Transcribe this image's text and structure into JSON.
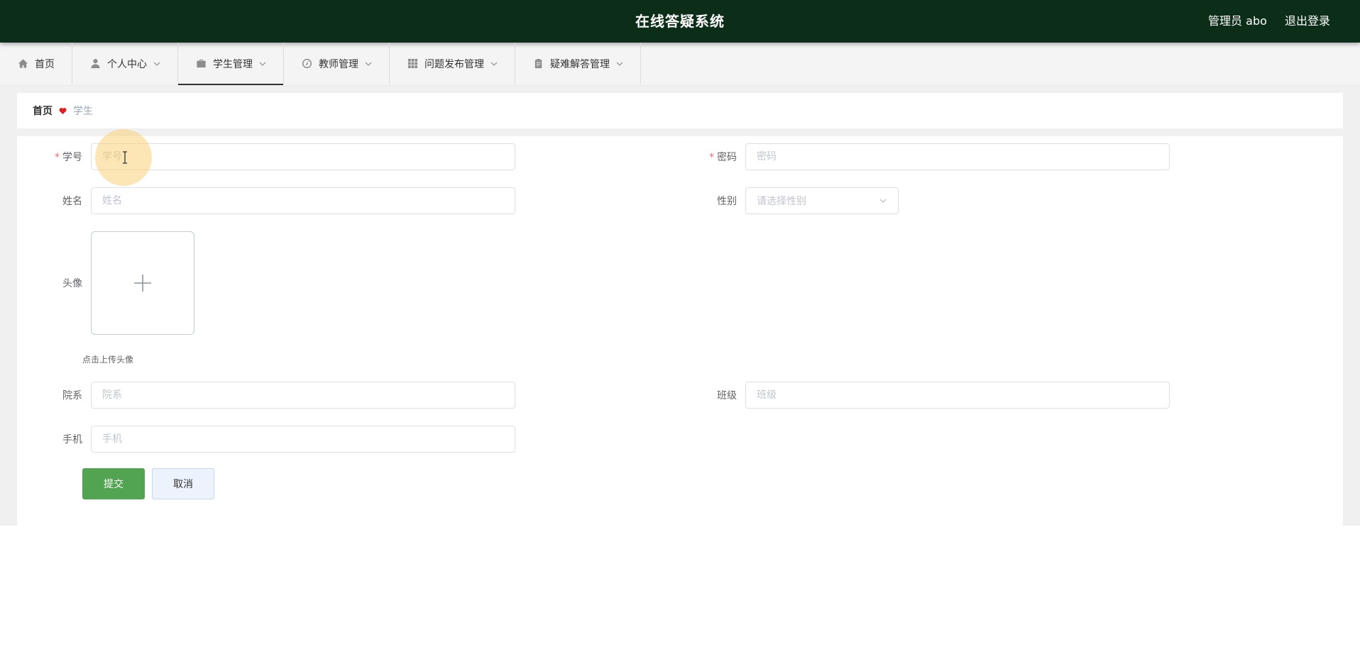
{
  "header": {
    "app_title": "在线答疑系统",
    "user_label": "管理员 abo",
    "logout_label": "退出登录"
  },
  "nav": {
    "items": [
      {
        "label": "首页",
        "icon": "home-icon",
        "has_dropdown": false
      },
      {
        "label": "个人中心",
        "icon": "user-icon",
        "has_dropdown": true
      },
      {
        "label": "学生管理",
        "icon": "briefcase-icon",
        "has_dropdown": true,
        "active": true
      },
      {
        "label": "教师管理",
        "icon": "dashboard-icon",
        "has_dropdown": true
      },
      {
        "label": "问题发布管理",
        "icon": "grid-icon",
        "has_dropdown": true
      },
      {
        "label": "疑难解答管理",
        "icon": "clipboard-icon",
        "has_dropdown": true
      }
    ]
  },
  "breadcrumb": {
    "home": "首页",
    "separator_icon": "heart-icon",
    "current": "学生"
  },
  "form": {
    "student_id": {
      "label": "学号",
      "placeholder": "学号",
      "value": "",
      "required": true
    },
    "password": {
      "label": "密码",
      "placeholder": "密码",
      "value": "",
      "required": true
    },
    "name": {
      "label": "姓名",
      "placeholder": "姓名",
      "value": ""
    },
    "gender": {
      "label": "性别",
      "placeholder": "请选择性别"
    },
    "avatar": {
      "label": "头像",
      "tip": "点击上传头像"
    },
    "department": {
      "label": "院系",
      "placeholder": "院系",
      "value": ""
    },
    "class": {
      "label": "班级",
      "placeholder": "班级",
      "value": ""
    },
    "phone": {
      "label": "手机",
      "placeholder": "手机",
      "value": ""
    },
    "submit_label": "提交",
    "cancel_label": "取消"
  },
  "colors": {
    "header_bg": "#0c2e18",
    "submit_bg": "#52a352",
    "required_mark": "#f56c6c",
    "separator_heart": "#e02020"
  }
}
